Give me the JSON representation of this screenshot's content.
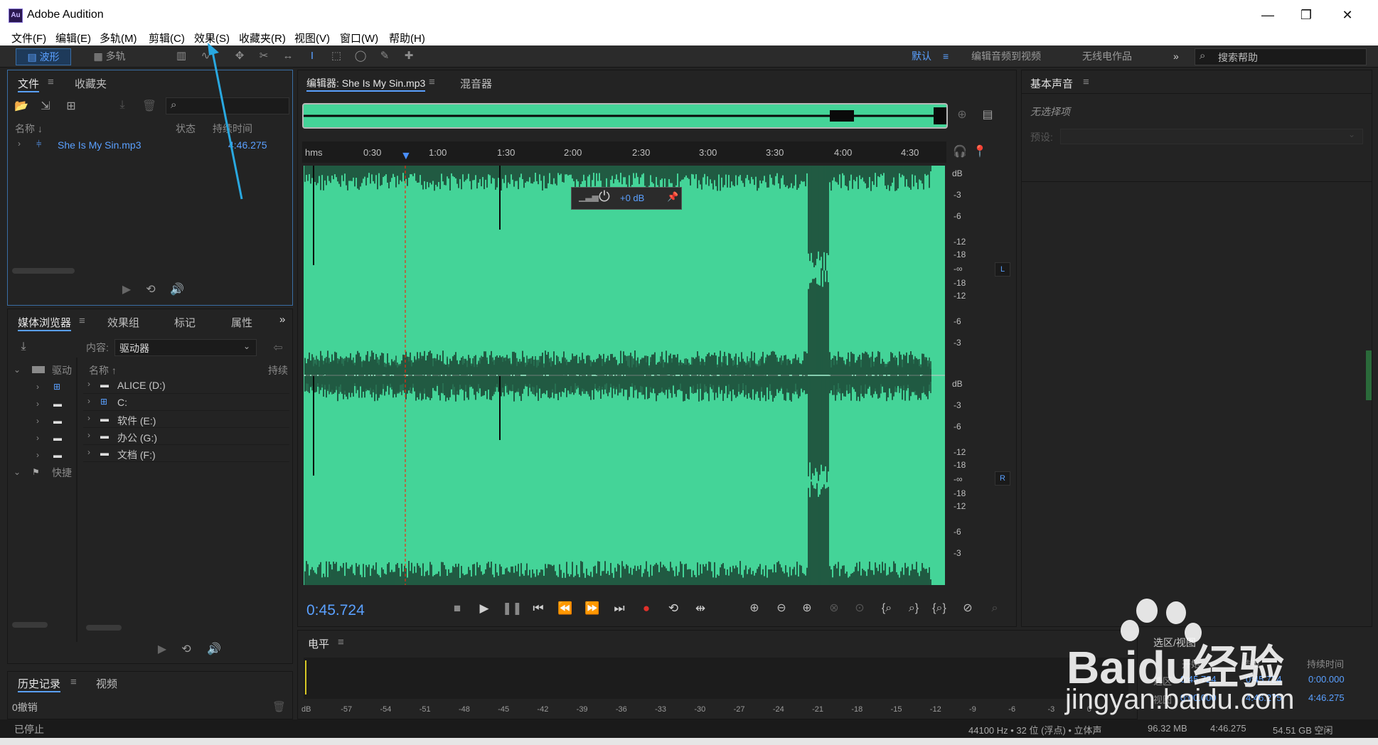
{
  "app": {
    "title": "Adobe Audition",
    "logo_text": "Au"
  },
  "window_controls": {
    "minimize": "—",
    "restore": "❐",
    "close": "✕"
  },
  "menu": [
    "文件(F)",
    "编辑(E)",
    "多轨(M)",
    "剪辑(C)",
    "效果(S)",
    "收藏夹(R)",
    "视图(V)",
    "窗口(W)",
    "帮助(H)"
  ],
  "toolbar": {
    "waveform_label": "波形",
    "multitrack_label": "多轨",
    "workspace_default": "默认",
    "workspace_edit_video": "编辑音频到视频",
    "workspace_radio": "无线电作品",
    "more": "»",
    "search_placeholder": "搜索帮助"
  },
  "files_panel": {
    "tab_files": "文件",
    "tab_favorites": "收藏夹",
    "menu_glyph": "≡",
    "col_name": "名称 ↓",
    "col_status": "状态",
    "col_duration": "持续时间",
    "file_name": "She Is My Sin.mp3",
    "file_duration": "4:46.275"
  },
  "media_panel": {
    "tab_media_browser": "媒体浏览器",
    "tab_effects_group": "效果组",
    "tab_markers": "标记",
    "tab_properties": "属性",
    "more": "»",
    "content_label": "内容:",
    "content_value": "驱动器",
    "tree_drives": "驱动",
    "tree_shortcuts": "快捷",
    "col_name": "名称 ↑",
    "col_duration": "持续",
    "drives": [
      "ALICE (D:)",
      "C:",
      "软件 (E:)",
      "办公 (G:)",
      "文档 (F:)"
    ]
  },
  "history_panel": {
    "tab_history": "历史记录",
    "tab_video": "视频",
    "undo_count": "0撤销",
    "status": "已停止"
  },
  "editor": {
    "tab_editor": "编辑器: She Is My Sin.mp3",
    "tab_mixer": "混音器",
    "ruler_unit": "hms",
    "ruler_ticks": [
      "0:30",
      "1:00",
      "1:30",
      "2:00",
      "2:30",
      "3:00",
      "3:30",
      "4:00",
      "4:30"
    ],
    "gain_label": "+0 dB",
    "db_scale_top": [
      "dB",
      "-3",
      "-6",
      "-12",
      "-18",
      "-∞",
      "-18",
      "-12",
      "-6",
      "-3"
    ],
    "db_scale_bottom": [
      "dB",
      "-3",
      "-6",
      "-12",
      "-18",
      "-∞",
      "-18",
      "-12",
      "-6",
      "-3"
    ],
    "channel_l": "L",
    "channel_r": "R",
    "current_time": "0:45.724",
    "waveform_color": "#44d498",
    "playhead_position_seconds": 45.724,
    "total_seconds": 286.275
  },
  "essential_sound": {
    "title": "基本声音",
    "no_selection": "无选择项",
    "preset_label": "预设:"
  },
  "level_panel": {
    "title": "电平",
    "scale": [
      "dB",
      "-57",
      "-54",
      "-51",
      "-48",
      "-45",
      "-42",
      "-39",
      "-36",
      "-33",
      "-30",
      "-27",
      "-24",
      "-21",
      "-18",
      "-15",
      "-12",
      "-9",
      "-6",
      "-3",
      "0"
    ]
  },
  "selection_view": {
    "title": "选区/视图",
    "col_start": "开始",
    "col_end": "结束",
    "col_duration": "持续时间",
    "row_selection_label": "选区",
    "row_selection_start": "0:45.724",
    "row_selection_end": "0:45.724",
    "row_selection_duration": "0:00.000",
    "row_view_label": "视图",
    "row_view_start": "0:00.000",
    "row_view_end": "4:46.275",
    "row_view_duration": "4:46.275"
  },
  "status_bar": {
    "state": "已停止",
    "sample_rate": "44100 Hz • 32 位 (浮点) • 立体声",
    "file_size": "96.32 MB",
    "duration": "4:46.275",
    "free_space": "54.51 GB 空闲"
  },
  "watermark": {
    "text": "Baidu经验",
    "sub": "jingyan.baidu.com"
  },
  "annotation_color": "#29a8e0"
}
